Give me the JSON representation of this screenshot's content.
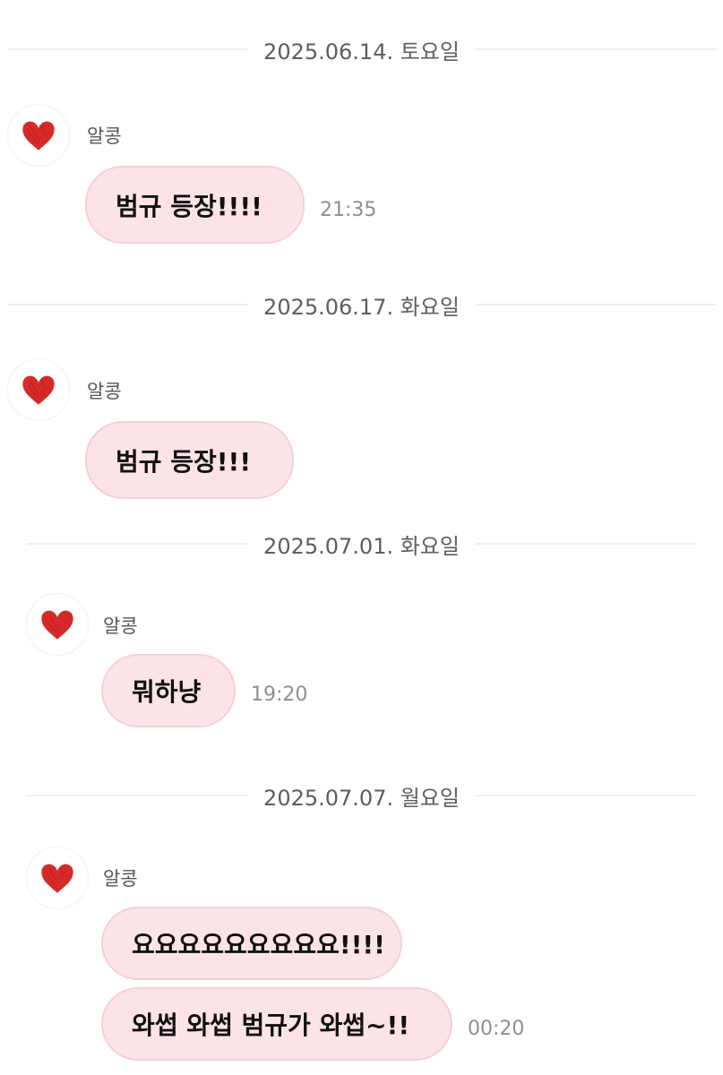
{
  "colors": {
    "bubble_bg": "#fbe3e7",
    "bubble_border": "#f4d0d7",
    "divider_line": "#eeeeee",
    "heart_red": "#d62a2a"
  },
  "avatar_icon": "heart-icon",
  "groups": [
    {
      "date": "2025.06.14. 토요일",
      "sender": "알콩",
      "messages": [
        {
          "text": "범규 등장!!!!",
          "time": "21:35"
        }
      ]
    },
    {
      "date": "2025.06.17. 화요일",
      "sender": "알콩",
      "messages": [
        {
          "text": "범규 등장!!!",
          "time": ""
        }
      ]
    },
    {
      "date": "2025.07.01. 화요일",
      "sender": "알콩",
      "messages": [
        {
          "text": "뭐하냥",
          "time": "19:20"
        }
      ]
    },
    {
      "date": "2025.07.07. 월요일",
      "sender": "알콩",
      "messages": [
        {
          "text": "요요요요요요요요요!!!!",
          "time": ""
        },
        {
          "text": "와썹 와썹 범규가 와썹~!!",
          "time": "00:20"
        }
      ]
    }
  ]
}
